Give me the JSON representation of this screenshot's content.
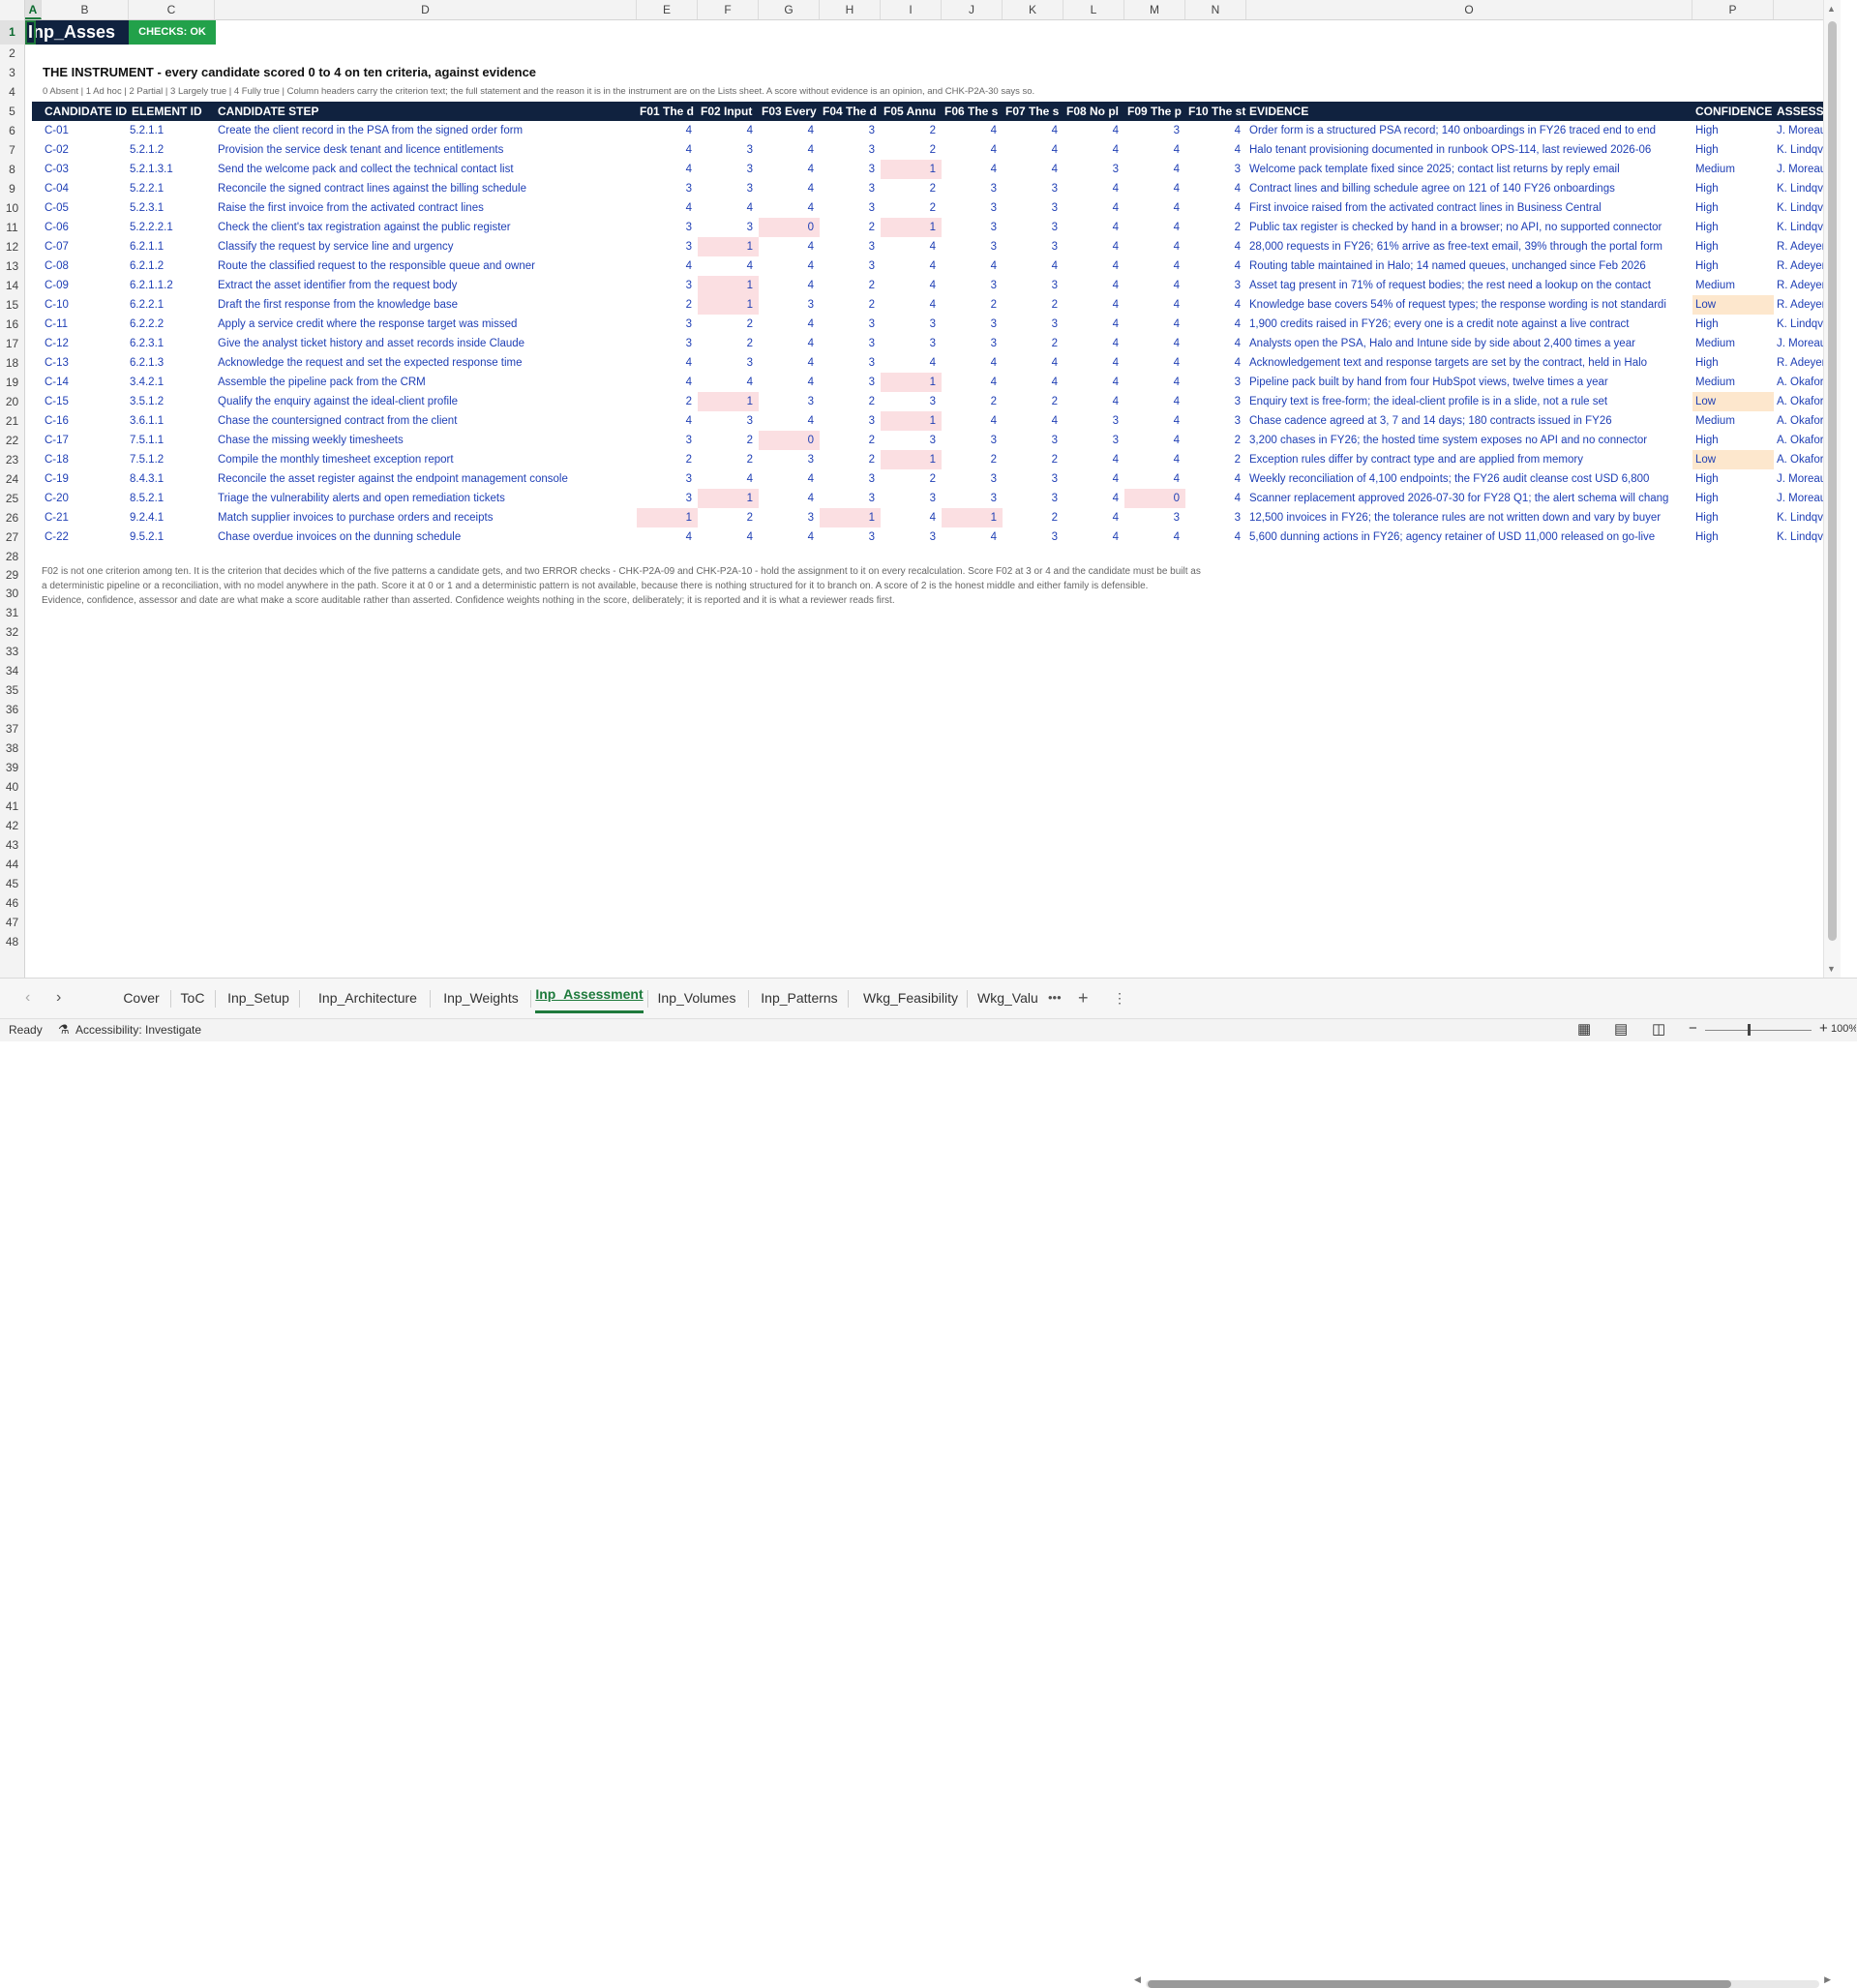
{
  "columns": [
    "A",
    "B",
    "C",
    "D",
    "E",
    "F",
    "G",
    "H",
    "I",
    "J",
    "K",
    "L",
    "M",
    "N",
    "O",
    "P"
  ],
  "rows": [
    "1",
    "2",
    "3",
    "4",
    "5",
    "6",
    "7",
    "8",
    "9",
    "10",
    "11",
    "12",
    "13",
    "14",
    "15",
    "16",
    "17",
    "18",
    "19",
    "20",
    "21",
    "22",
    "23",
    "24",
    "25",
    "26",
    "27",
    "28",
    "29",
    "30",
    "31",
    "32",
    "33",
    "34",
    "35",
    "36",
    "37",
    "38",
    "39",
    "40",
    "41",
    "42",
    "43",
    "44",
    "45",
    "46",
    "47",
    "48"
  ],
  "title": "Inp_Asses",
  "checks": "CHECKS: OK",
  "heading": "THE INSTRUMENT - every candidate scored 0 to 4 on ten criteria, against evidence",
  "legend": "0 Absent  |  1 Ad hoc  |  2 Partial  |  3 Largely true  |  4 Fully true  |   Column headers carry the criterion text; the full statement and the reason it is in the instrument are on the Lists sheet. A score without evidence is an opinion, and CHK-P2A-30 says so.",
  "headers": [
    "CANDIDATE ID",
    "ELEMENT ID",
    "CANDIDATE STEP",
    "F01 The d",
    "F02 Input",
    "F03 Every",
    "F04 The d",
    "F05 Annu",
    "F06 The s",
    "F07 The s",
    "F08 No pl",
    "F09 The p",
    "F10 The st",
    "EVIDENCE",
    "CONFIDENCE",
    "ASSESSOR"
  ],
  "table": [
    {
      "id": "C-01",
      "el": "5.2.1.1",
      "step": "Create the client record in the PSA from the signed order form",
      "s": [
        "4",
        "4",
        "4",
        "3",
        "2",
        "4",
        "4",
        "4",
        "3",
        "4"
      ],
      "ev": "Order form is a structured PSA record; 140 onboardings in FY26 traced end to end",
      "conf": "High",
      "as": "J. Moreau ("
    },
    {
      "id": "C-02",
      "el": "5.2.1.2",
      "step": "Provision the service desk tenant and licence entitlements",
      "s": [
        "4",
        "3",
        "4",
        "3",
        "2",
        "4",
        "4",
        "4",
        "4",
        "4"
      ],
      "ev": "Halo tenant provisioning documented in runbook OPS-114, last reviewed 2026-06",
      "conf": "High",
      "as": "K. Lindqvis"
    },
    {
      "id": "C-03",
      "el": "5.2.1.3.1",
      "step": "Send the welcome pack and collect the technical contact list",
      "s": [
        "4",
        "3",
        "4",
        "3",
        "1",
        "4",
        "4",
        "3",
        "4",
        "3"
      ],
      "ev": "Welcome pack template fixed since 2025; contact list returns by reply email",
      "conf": "Medium",
      "as": "J. Moreau ("
    },
    {
      "id": "C-04",
      "el": "5.2.2.1",
      "step": "Reconcile the signed contract lines against the billing schedule",
      "s": [
        "3",
        "3",
        "4",
        "3",
        "2",
        "3",
        "3",
        "4",
        "4",
        "4"
      ],
      "ev": "Contract lines and billing schedule agree on 121 of 140 FY26 onboardings",
      "conf": "High",
      "as": "K. Lindqvis"
    },
    {
      "id": "C-05",
      "el": "5.2.3.1",
      "step": "Raise the first invoice from the activated contract lines",
      "s": [
        "4",
        "4",
        "4",
        "3",
        "2",
        "3",
        "3",
        "4",
        "4",
        "4"
      ],
      "ev": "First invoice raised from the activated contract lines in Business Central",
      "conf": "High",
      "as": "K. Lindqvis"
    },
    {
      "id": "C-06",
      "el": "5.2.2.2.1",
      "step": "Check the client's tax registration against the public register",
      "s": [
        "3",
        "3",
        "0",
        "2",
        "1",
        "3",
        "3",
        "4",
        "4",
        "2"
      ],
      "ev": "Public tax register is checked by hand in a browser; no API, no supported connector",
      "conf": "High",
      "as": "K. Lindqvis"
    },
    {
      "id": "C-07",
      "el": "6.2.1.1",
      "step": "Classify the request by service line and urgency",
      "s": [
        "3",
        "1",
        "4",
        "3",
        "4",
        "3",
        "3",
        "4",
        "4",
        "4"
      ],
      "ev": "28,000 requests in FY26; 61% arrive as free-text email, 39% through the portal form",
      "conf": "High",
      "as": "R. Adeyemi"
    },
    {
      "id": "C-08",
      "el": "6.2.1.2",
      "step": "Route the classified request to the responsible queue and owner",
      "s": [
        "4",
        "4",
        "4",
        "3",
        "4",
        "4",
        "4",
        "4",
        "4",
        "4"
      ],
      "ev": "Routing table maintained in Halo; 14 named queues, unchanged since Feb 2026",
      "conf": "High",
      "as": "R. Adeyemi"
    },
    {
      "id": "C-09",
      "el": "6.2.1.1.2",
      "step": "Extract the asset identifier from the request body",
      "s": [
        "3",
        "1",
        "4",
        "2",
        "4",
        "3",
        "3",
        "4",
        "4",
        "3"
      ],
      "ev": "Asset tag present in 71% of request bodies; the rest need a lookup on the contact",
      "conf": "Medium",
      "as": "R. Adeyemi"
    },
    {
      "id": "C-10",
      "el": "6.2.2.1",
      "step": "Draft the first response from the knowledge base",
      "s": [
        "2",
        "1",
        "3",
        "2",
        "4",
        "2",
        "2",
        "4",
        "4",
        "4"
      ],
      "ev": "Knowledge base covers 54% of request types; the response wording is not standardi",
      "conf": "Low",
      "as": "R. Adeyemi"
    },
    {
      "id": "C-11",
      "el": "6.2.2.2",
      "step": "Apply a service credit where the response target was missed",
      "s": [
        "3",
        "2",
        "4",
        "3",
        "3",
        "3",
        "3",
        "4",
        "4",
        "4"
      ],
      "ev": "1,900 credits raised in FY26; every one is a credit note against a live contract",
      "conf": "High",
      "as": "K. Lindqvis"
    },
    {
      "id": "C-12",
      "el": "6.2.3.1",
      "step": "Give the analyst ticket history and asset records inside Claude",
      "s": [
        "3",
        "2",
        "4",
        "3",
        "3",
        "3",
        "2",
        "4",
        "4",
        "4"
      ],
      "ev": "Analysts open the PSA, Halo and Intune side by side about 2,400 times a year",
      "conf": "Medium",
      "as": "J. Moreau ("
    },
    {
      "id": "C-13",
      "el": "6.2.1.3",
      "step": "Acknowledge the request and set the expected response time",
      "s": [
        "4",
        "3",
        "4",
        "3",
        "4",
        "4",
        "4",
        "4",
        "4",
        "4"
      ],
      "ev": "Acknowledgement text and response targets are set by the contract, held in Halo",
      "conf": "High",
      "as": "R. Adeyemi"
    },
    {
      "id": "C-14",
      "el": "3.4.2.1",
      "step": "Assemble the pipeline pack from the CRM",
      "s": [
        "4",
        "4",
        "4",
        "3",
        "1",
        "4",
        "4",
        "4",
        "4",
        "3"
      ],
      "ev": "Pipeline pack built by hand from four HubSpot views, twelve times a year",
      "conf": "Medium",
      "as": "A. Okafor (T"
    },
    {
      "id": "C-15",
      "el": "3.5.1.2",
      "step": "Qualify the enquiry against the ideal-client profile",
      "s": [
        "2",
        "1",
        "3",
        "2",
        "3",
        "2",
        "2",
        "4",
        "4",
        "3"
      ],
      "ev": "Enquiry text is free-form; the ideal-client profile is in a slide, not a rule set",
      "conf": "Low",
      "as": "A. Okafor (T"
    },
    {
      "id": "C-16",
      "el": "3.6.1.1",
      "step": "Chase the countersigned contract from the client",
      "s": [
        "4",
        "3",
        "4",
        "3",
        "1",
        "4",
        "4",
        "3",
        "4",
        "3"
      ],
      "ev": "Chase cadence agreed at 3, 7 and 14 days; 180 contracts issued in FY26",
      "conf": "Medium",
      "as": "A. Okafor (T"
    },
    {
      "id": "C-17",
      "el": "7.5.1.1",
      "step": "Chase the missing weekly timesheets",
      "s": [
        "3",
        "2",
        "0",
        "2",
        "3",
        "3",
        "3",
        "3",
        "4",
        "2"
      ],
      "ev": "3,200 chases in FY26; the hosted time system exposes no API and no connector",
      "conf": "High",
      "as": "A. Okafor (T"
    },
    {
      "id": "C-18",
      "el": "7.5.1.2",
      "step": "Compile the monthly timesheet exception report",
      "s": [
        "2",
        "2",
        "3",
        "2",
        "1",
        "2",
        "2",
        "4",
        "4",
        "2"
      ],
      "ev": "Exception rules differ by contract type and are applied from memory",
      "conf": "Low",
      "as": "A. Okafor (T"
    },
    {
      "id": "C-19",
      "el": "8.4.3.1",
      "step": "Reconcile the asset register against the endpoint management console",
      "s": [
        "3",
        "4",
        "4",
        "3",
        "2",
        "3",
        "3",
        "4",
        "4",
        "4"
      ],
      "ev": "Weekly reconciliation of 4,100 endpoints; the FY26 audit cleanse cost USD 6,800",
      "conf": "High",
      "as": "J. Moreau ("
    },
    {
      "id": "C-20",
      "el": "8.5.2.1",
      "step": "Triage the vulnerability alerts and open remediation tickets",
      "s": [
        "3",
        "1",
        "4",
        "3",
        "3",
        "3",
        "3",
        "4",
        "0",
        "4"
      ],
      "ev": "Scanner replacement approved 2026-07-30 for FY28 Q1; the alert schema will chang",
      "conf": "High",
      "as": "J. Moreau ("
    },
    {
      "id": "C-21",
      "el": "9.2.4.1",
      "step": "Match supplier invoices to purchase orders and receipts",
      "s": [
        "1",
        "2",
        "3",
        "1",
        "4",
        "1",
        "2",
        "4",
        "3",
        "3"
      ],
      "ev": "12,500 invoices in FY26; the tolerance rules are not written down and vary by buyer",
      "conf": "High",
      "as": "K. Lindqvis"
    },
    {
      "id": "C-22",
      "el": "9.5.2.1",
      "step": "Chase overdue invoices on the dunning schedule",
      "s": [
        "4",
        "4",
        "4",
        "3",
        "3",
        "4",
        "3",
        "4",
        "4",
        "4"
      ],
      "ev": "5,600 dunning actions in FY26; agency retainer of USD 11,000 released on go-live",
      "conf": "High",
      "as": "K. Lindqvis"
    }
  ],
  "notes": [
    "F02 is not one criterion among ten. It is the criterion that decides which of the five patterns a candidate gets, and two ERROR checks - CHK-P2A-09 and CHK-P2A-10 - hold the assignment to it on every recalculation. Score F02 at 3 or 4 and the candidate must be built as",
    "a deterministic pipeline or a reconciliation, with no model anywhere in the path. Score it at 0 or 1 and a deterministic pattern is not available, because there is nothing structured for it to branch on. A score of 2 is the honest middle and either family is defensible.",
    "Evidence, confidence, assessor and date are what make a score auditable rather than asserted. Confidence weights nothing in the score, deliberately; it is reported and it is what a reviewer reads first."
  ],
  "tabs": [
    "Cover",
    "ToC",
    "Inp_Setup",
    "Inp_Architecture",
    "Inp_Weights",
    "Inp_Assessment",
    "Inp_Volumes",
    "Inp_Patterns",
    "Wkg_Feasibility",
    "Wkg_Valu"
  ],
  "active_tab": "Inp_Assessment",
  "tabs_more": "•••",
  "add_sheet": "+",
  "status": {
    "ready": "Ready",
    "accessibility": "Accessibility: Investigate",
    "zoom": "100%"
  }
}
